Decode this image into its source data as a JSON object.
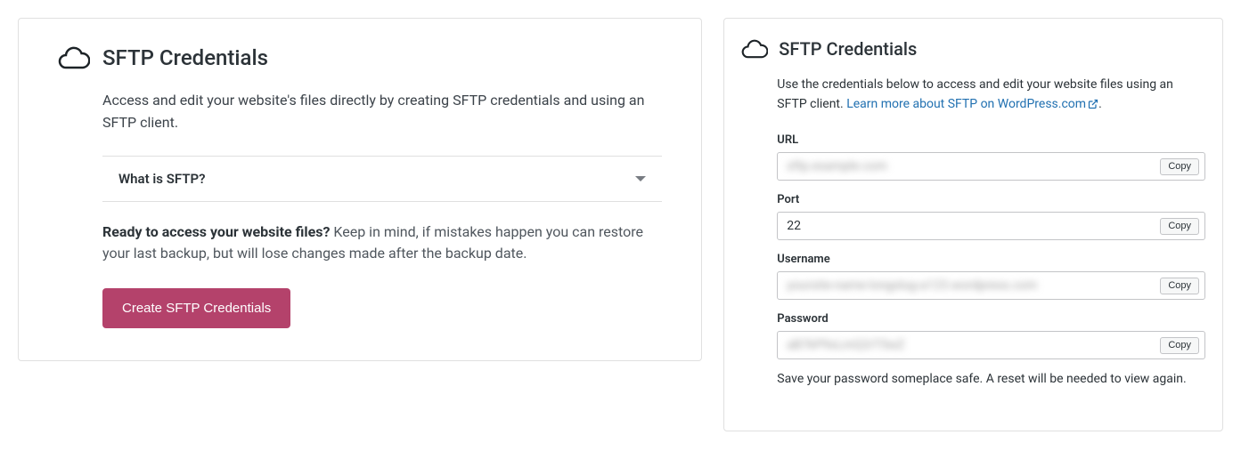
{
  "left": {
    "title": "SFTP Credentials",
    "description": "Access and edit your website's files directly by creating SFTP credentials and using an SFTP client.",
    "accordion_label": "What is SFTP?",
    "ready_bold": "Ready to access your website files?",
    "ready_rest": " Keep in mind, if mistakes happen you can restore your last backup, but will lose changes made after the backup date.",
    "button_label": "Create SFTP Credentials"
  },
  "right": {
    "title": "SFTP Credentials",
    "desc_prefix": "Use the credentials below to access and edit your website files using an SFTP client. ",
    "link_label": "Learn more about SFTP on WordPress.com",
    "desc_suffix": ".",
    "copy_label": "Copy",
    "fields": {
      "url_label": "URL",
      "url_value": "sftp.example.com",
      "port_label": "Port",
      "port_value": "22",
      "username_label": "Username",
      "username_value": "yoursite-name-longslug-a123.wordpress.com",
      "password_label": "Password",
      "password_value": "aB7kP9xLmQ2rT5wZ"
    },
    "note": "Save your password someplace safe. A reset will be needed to view again."
  }
}
